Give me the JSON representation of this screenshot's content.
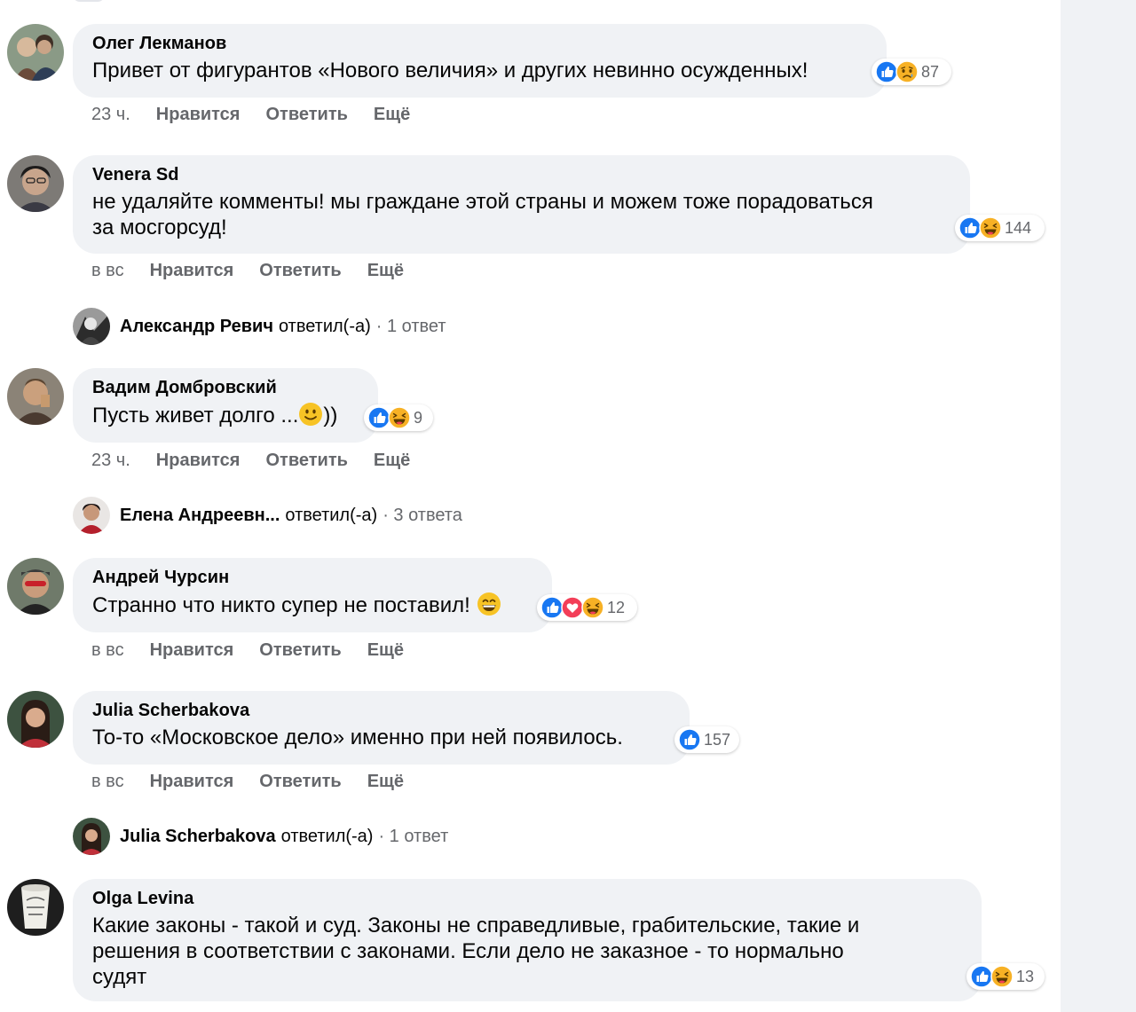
{
  "comments": [
    {
      "author": "Олег Лекманов",
      "text": "Привет от фигурантов «Нового величия» и других невинно осужденных!",
      "reactions": [
        "like-icon",
        "sad-icon"
      ],
      "reaction_count": "87",
      "time": "23 ч.",
      "like": "Нравится",
      "reply": "Ответить",
      "more": "Ещё"
    },
    {
      "author": "Venera Sd",
      "text_line1": "не удаляйте комменты! мы граждане этой страны и можем тоже порадоваться",
      "text_line2": "за мосгорсуд!",
      "reactions": [
        "like-icon",
        "haha-icon"
      ],
      "reaction_count": "144",
      "time": "в вс",
      "like": "Нравится",
      "reply": "Ответить",
      "more": "Ещё",
      "replies": {
        "name": "Александр Ревич",
        "verb": "ответил(-а)",
        "count": "· 1 ответ"
      }
    },
    {
      "author": "Вадим Домбровский",
      "text_before": "Пусть живет долго ...",
      "text_after": "))",
      "inline_emoji": "slight-smile-emoji",
      "reactions": [
        "like-icon",
        "haha-icon"
      ],
      "reaction_count": "9",
      "time": "23 ч.",
      "like": "Нравится",
      "reply": "Ответить",
      "more": "Ещё",
      "replies": {
        "name": "Елена Андреевн...",
        "verb": "ответил(-а)",
        "count": "· 3 ответа"
      }
    },
    {
      "author": "Андрей Чурсин",
      "text": "Странно что никто супер не поставил!",
      "inline_emoji": "grin-emoji",
      "reactions": [
        "like-icon",
        "love-icon",
        "haha-icon"
      ],
      "reaction_count": "12",
      "time": "в вс",
      "like": "Нравится",
      "reply": "Ответить",
      "more": "Ещё"
    },
    {
      "author": "Julia Scherbakova",
      "text": "То-то «Московское дело» именно при ней появилось.",
      "reactions": [
        "like-icon"
      ],
      "reaction_count": "157",
      "time": "в вс",
      "like": "Нравится",
      "reply": "Ответить",
      "more": "Ещё",
      "replies": {
        "name": "Julia Scherbakova",
        "verb": "ответил(-а)",
        "count": "· 1 ответ"
      }
    },
    {
      "author": "Olga Levina",
      "text_line1": "Какие законы - такой и суд. Законы не справедливые, грабительские, такие и",
      "text_line2": "решения в соответствии с законами. Если дело не заказное - то нормально",
      "text_line3": "судят",
      "reactions": [
        "like-icon",
        "haha-icon"
      ],
      "reaction_count": "13"
    }
  ],
  "colors": {
    "bubble": "#f0f2f5",
    "secondary_text": "#65676b",
    "like_blue": "#1877f2",
    "love_red": "#f33e58",
    "emoji_yellow": "#f7b125"
  }
}
